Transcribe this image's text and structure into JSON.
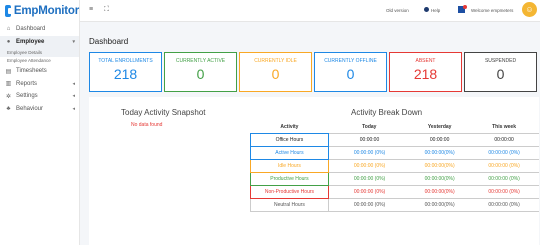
{
  "brand": {
    "logo_text": "EmpMonitor",
    "icon": "empmonitor-logo-icon"
  },
  "sidebar": {
    "items": [
      {
        "label": "Dashboard",
        "icon": "home-icon"
      },
      {
        "label": "Employee",
        "icon": "user-icon"
      },
      {
        "label": "Timesheets",
        "icon": "clipboard-icon"
      },
      {
        "label": "Reports",
        "icon": "report-icon"
      },
      {
        "label": "Settings",
        "icon": "gear-icon"
      },
      {
        "label": "Behaviour",
        "icon": "users-icon"
      }
    ],
    "employee_sub": [
      {
        "label": "Employee Details"
      },
      {
        "label": "Employee Attendance"
      }
    ]
  },
  "topbar": {
    "version": "Old version",
    "help": "Help",
    "welcome": "Welcome empmeters"
  },
  "dashboard": {
    "title": "Dashboard",
    "cards": [
      {
        "label": "TOTAL ENROLLMENTS",
        "value": "218",
        "color": "#1e88e5"
      },
      {
        "label": "CURRENTLY ACTIVE",
        "value": "0",
        "color": "#43a047"
      },
      {
        "label": "CURRENTLY IDLE",
        "value": "0",
        "color": "#f9a825"
      },
      {
        "label": "CURRENTLY OFFLINE",
        "value": "0",
        "color": "#1e88e5"
      },
      {
        "label": "ABSENT",
        "value": "218",
        "color": "#e53935"
      },
      {
        "label": "SUSPENDED",
        "value": "0",
        "color": "#444444"
      }
    ]
  },
  "snapshot": {
    "title": "Today Activity Snapshot",
    "no_data": "No data found"
  },
  "breakdown": {
    "title": "Activity Break Down",
    "headers": [
      "Activity",
      "Today",
      "Yesterday",
      "This week"
    ],
    "rows": [
      {
        "label": "Office Hours",
        "today": "00:00:00",
        "yesterday": "00:00:00",
        "week": "00:00:00",
        "color": "#222222",
        "border": "#1e88e5"
      },
      {
        "label": "Active Hours",
        "today": "00:00:00 (0%)",
        "yesterday": "00:00:00(0%)",
        "week": "00:00:00 (0%)",
        "color": "#1e88e5",
        "border": "#1e88e5"
      },
      {
        "label": "Idle Hours",
        "today": "00:00:00 (0%)",
        "yesterday": "00:00:00(0%)",
        "week": "00:00:00 (0%)",
        "color": "#f9a825",
        "border": "#f9a825"
      },
      {
        "label": "Productive Hours",
        "today": "00:00:00 (0%)",
        "yesterday": "00:00:00(0%)",
        "week": "00:00:00 (0%)",
        "color": "#43a047",
        "border": "#43a047"
      },
      {
        "label": "Non-Productive Hours",
        "today": "00:00:00 (0%)",
        "yesterday": "00:00:00(0%)",
        "week": "00:00:00 (0%)",
        "color": "#e53935",
        "border": "#e53935"
      },
      {
        "label": "Neutral Hours",
        "today": "00:00:00 (0%)",
        "yesterday": "00:00:00(0%)",
        "week": "00:00:00 (0%)",
        "color": "#555555",
        "border": "#cccccc"
      }
    ]
  }
}
